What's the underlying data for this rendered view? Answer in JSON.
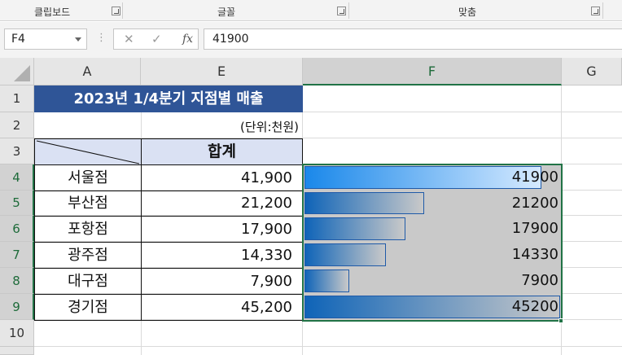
{
  "ribbon": {
    "groups": [
      {
        "label": "클립보드"
      },
      {
        "label": "글꼴"
      },
      {
        "label": "맞춤"
      }
    ]
  },
  "formula_bar": {
    "name_box": "F4",
    "dots": "⋮",
    "cancel_icon": "✕",
    "enter_icon": "✓",
    "fx_label": "fx",
    "formula": "41900"
  },
  "columns": [
    {
      "label": "A"
    },
    {
      "label": "E"
    },
    {
      "label": "F",
      "selected": true
    },
    {
      "label": "G"
    }
  ],
  "rows": [
    {
      "label": "1"
    },
    {
      "label": "2"
    },
    {
      "label": "3"
    },
    {
      "label": "4"
    },
    {
      "label": "5"
    },
    {
      "label": "6"
    },
    {
      "label": "7"
    },
    {
      "label": "8"
    },
    {
      "label": "9"
    },
    {
      "label": "10"
    }
  ],
  "sheet": {
    "title": "2023년 1/4분기 지점별 매출",
    "unit": "(단위:천원)",
    "total_header": "합계",
    "branches": [
      {
        "name": "서울점",
        "total": "41,900",
        "bar_value": "41900",
        "value": 41900
      },
      {
        "name": "부산점",
        "total": "21,200",
        "bar_value": "21200",
        "value": 21200
      },
      {
        "name": "포항점",
        "total": "17,900",
        "bar_value": "17900",
        "value": 17900
      },
      {
        "name": "광주점",
        "total": "14,330",
        "bar_value": "14330",
        "value": 14330
      },
      {
        "name": "대구점",
        "total": "7,900",
        "bar_value": "7900",
        "value": 7900
      },
      {
        "name": "경기점",
        "total": "45,200",
        "bar_value": "45200",
        "value": 45200
      }
    ],
    "data_bar_max": 45200
  },
  "colors": {
    "title_fill": "#2f5597",
    "header_fill": "#dae1f3",
    "bar_start": "#0f64b8",
    "bar_end_selected": "#d6eaff",
    "selection": "#217346"
  }
}
